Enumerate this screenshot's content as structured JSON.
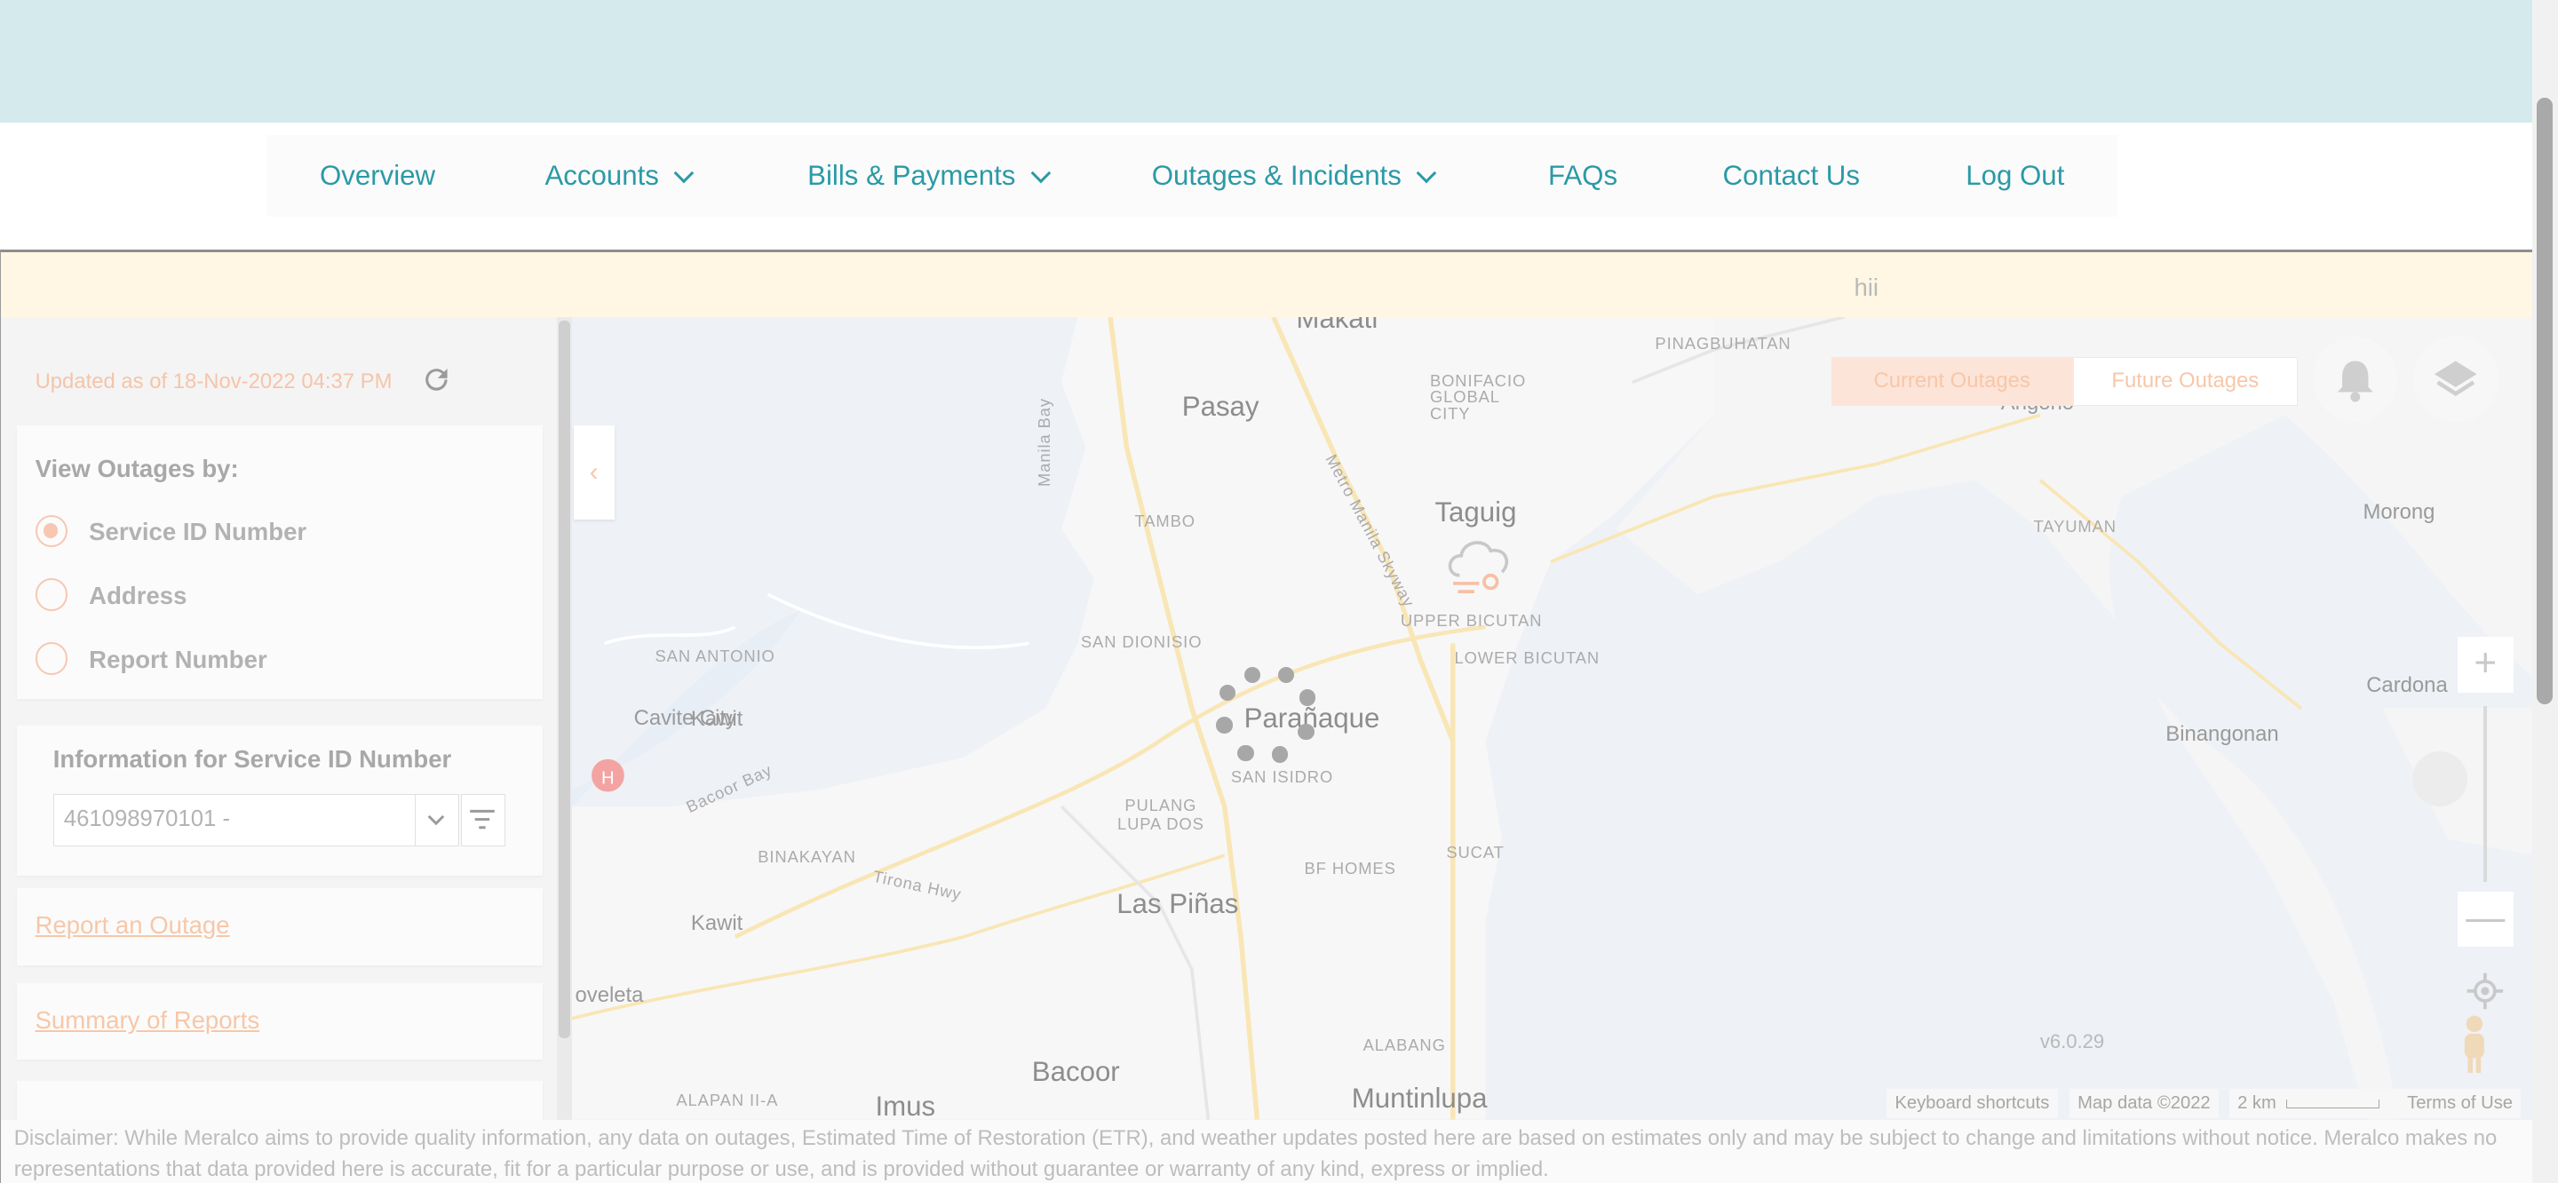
{
  "nav": {
    "items": [
      {
        "label": "Overview",
        "has_menu": false
      },
      {
        "label": "Accounts",
        "has_menu": true
      },
      {
        "label": "Bills & Payments",
        "has_menu": true
      },
      {
        "label": "Outages & Incidents",
        "has_menu": true
      },
      {
        "label": "FAQs",
        "has_menu": false
      },
      {
        "label": "Contact Us",
        "has_menu": false
      },
      {
        "label": "Log Out",
        "has_menu": false
      }
    ]
  },
  "banner": {
    "text": "hii"
  },
  "panel": {
    "updated": "Updated as of 18-Nov-2022 04:37 PM",
    "view_by_label": "View Outages by:",
    "options": [
      {
        "label": "Service ID Number",
        "selected": true
      },
      {
        "label": "Address",
        "selected": false
      },
      {
        "label": "Report Number",
        "selected": false
      }
    ],
    "info_label": "Information for Service ID Number",
    "service_id_value": "461098970101 -",
    "report_link": "Report an Outage",
    "summary_link": "Summary of Reports"
  },
  "map": {
    "tabs": {
      "current": "Current Outages",
      "future": "Future Outages"
    },
    "labels": {
      "makati": "Makati",
      "pasay": "Pasay",
      "taguig": "Taguig",
      "paranaque": "Parañaque",
      "las_pinas": "Las Piñas",
      "bacoor": "Bacoor",
      "muntinlupa": "Muntinlupa",
      "kawit": "Kawit",
      "cavite_city": "Cavite City",
      "imus": "Imus",
      "morong": "Morong",
      "cardona": "Cardona",
      "binangonan": "Binangonan",
      "noveleta": "oveleta",
      "pinagbuhatan": "PINAGBUHATAN",
      "bonifacio": "BONIFACIO GLOBAL CITY",
      "tambo": "TAMBO",
      "san_dionisio": "SAN DIONISIO",
      "san_antonio": "SAN ANTONIO",
      "upper_bicutan": "UPPER BICUTAN",
      "lower_bicutan": "LOWER BICUTAN",
      "san_isidro": "SAN ISIDRO",
      "pulang_lupa": "PULANG LUPA DOS",
      "binakayan": "BINAKAYAN",
      "bf_homes": "BF HOMES",
      "sucat": "SUCAT",
      "alabang": "ALABANG",
      "alapan": "ALAPAN II-A",
      "tayuman": "TAYUMAN",
      "angono": "Angono",
      "manila_bay": "Manila Bay",
      "bacoor_bay": "Bacoor Bay",
      "skyway": "Metro Manila Skyway",
      "tirona": "Tirona Hwy"
    },
    "version": "v6.0.29",
    "attribution": {
      "shortcuts": "Keyboard shortcuts",
      "data": "Map data ©2022",
      "scale": "2 km",
      "terms": "Terms of Use"
    },
    "zoom_plus": "+",
    "zoom_minus": "—",
    "collapse_icon": "‹"
  },
  "disclaimer": "Disclaimer: While Meralco aims to provide quality information, any data on outages, Estimated Time of Restoration (ETR), and weather updates posted here are based on estimates only and may be subject to change and limitations without notice. Meralco makes no representations that data provided here is accurate, fit for a particular purpose or use, and is provided without guarantee or warranty of any kind, express or implied.",
  "colors": {
    "teal": "#2a9aa6",
    "accent_light": "#f7c7a8",
    "banner_bg": "#fff7e3"
  }
}
